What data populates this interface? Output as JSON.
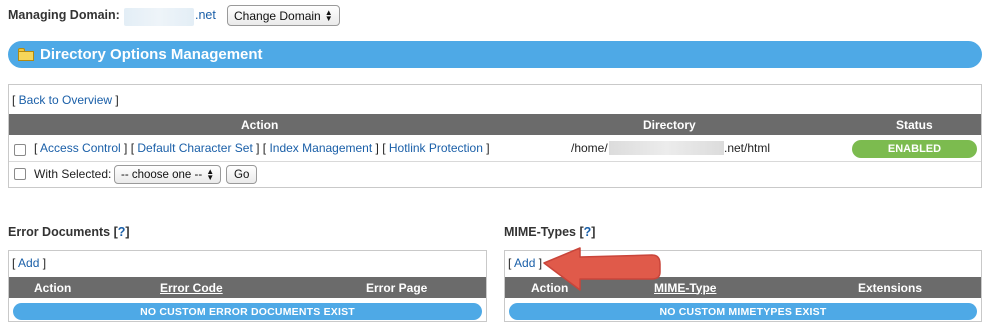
{
  "header": {
    "managing_label": "Managing Domain:",
    "domain_suffix": ".net",
    "change_domain": "Change Domain"
  },
  "page_title": "Directory Options Management",
  "directory": {
    "back_link": "Back to Overview",
    "columns": [
      "Action",
      "Directory",
      "Status"
    ],
    "row": {
      "actions": [
        "Access Control",
        "Default Character Set",
        "Index Management",
        "Hotlink Protection"
      ],
      "dir_prefix": "/home/",
      "dir_suffix": ".net/html",
      "status": "ENABLED"
    },
    "with_selected": "With Selected:",
    "choose": "-- choose one --",
    "go": "Go"
  },
  "error_docs": {
    "title": "Error Documents",
    "help": "?",
    "add": "Add",
    "columns": [
      "Action",
      "Error Code",
      "Error Page"
    ],
    "empty": "NO CUSTOM ERROR DOCUMENTS EXIST"
  },
  "mime": {
    "title": "MIME-Types",
    "help": "?",
    "add": "Add",
    "columns": [
      "Action",
      "MIME-Type",
      "Extensions"
    ],
    "empty": "NO CUSTOM MIMETYPES EXIST"
  },
  "colors": {
    "accent": "#4ea9e6",
    "header_gray": "#6b6b6b",
    "enabled": "#7cbb4f",
    "arrow": "#e05a4a"
  }
}
